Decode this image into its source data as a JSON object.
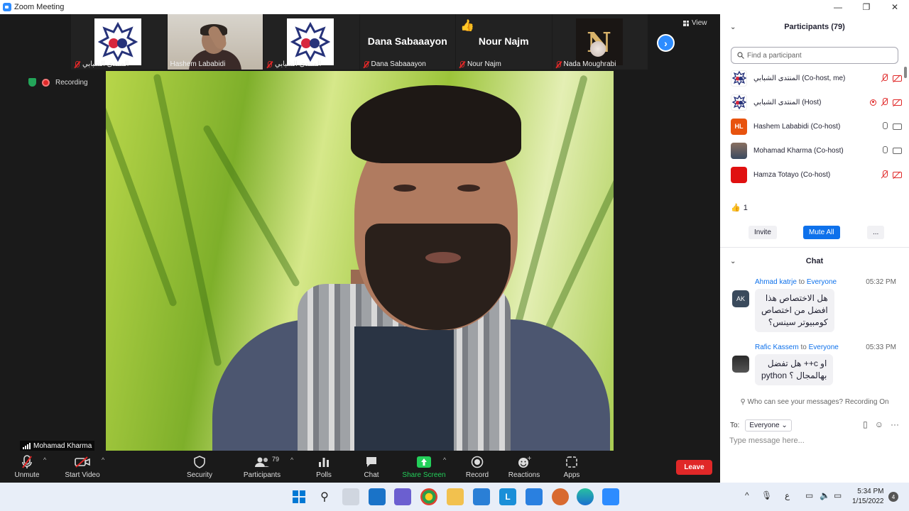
{
  "window": {
    "title": "Zoom Meeting"
  },
  "strip": {
    "tiles": [
      {
        "name": "المنتدى الشبابي",
        "type": "logo"
      },
      {
        "name": "Hashem Lababidi",
        "type": "video"
      },
      {
        "name": "المنتدى الشبابي",
        "type": "logo"
      },
      {
        "name": "Dana Sabaaayon",
        "type": "text",
        "big": "Dana Sabaaayon"
      },
      {
        "name": "Nour Najm",
        "type": "text",
        "big": "Nour Najm",
        "reaction": "👍"
      },
      {
        "name": "Nada Moughrabi",
        "type": "photo"
      }
    ],
    "view_label": "View"
  },
  "status": {
    "recording": "Recording"
  },
  "active_speaker": {
    "name": "Mohamad Kharma"
  },
  "toolbar": {
    "unmute": "Unmute",
    "start_video": "Start Video",
    "security": "Security",
    "participants": "Participants",
    "participants_count": "79",
    "polls": "Polls",
    "chat": "Chat",
    "share_screen": "Share Screen",
    "record": "Record",
    "reactions": "Reactions",
    "apps": "Apps",
    "leave": "Leave"
  },
  "participants_panel": {
    "title": "Participants (79)",
    "search_placeholder": "Find a participant",
    "rows": [
      {
        "name": "المنتدى الشبابي (Co-host, me)",
        "avatar": "logo",
        "mic": "off",
        "cam": "off",
        "rec": false
      },
      {
        "name": "المنتدى الشبابي (Host)",
        "avatar": "logo",
        "mic": "off",
        "cam": "off",
        "rec": true
      },
      {
        "name": "Hashem Lababidi (Co-host)",
        "avatar": "HL",
        "avatar_color": "#e8530e",
        "mic": "on",
        "cam": "on",
        "rec": false
      },
      {
        "name": "Mohamad Kharma (Co-host)",
        "avatar": "photo",
        "mic": "on",
        "cam": "on",
        "rec": false
      },
      {
        "name": "Hamza Totayo (Co-host)",
        "avatar": "",
        "avatar_color": "#e01010",
        "mic": "off",
        "cam": "off",
        "rec": false
      }
    ],
    "reaction_summary": {
      "emoji": "👍",
      "count": "1"
    },
    "invite": "Invite",
    "mute_all": "Mute All",
    "more": "..."
  },
  "chat_panel": {
    "title": "Chat",
    "messages": [
      {
        "sender": "Ahmad katrje",
        "to": "to",
        "recipient": "Everyone",
        "time": "05:32 PM",
        "avatar": "AK",
        "text_lines": [
          "هل الاختصاص هذا",
          "افضل من اختصاص",
          "كومبيوتر سينس؟"
        ]
      },
      {
        "sender": "Rafic Kassem",
        "to": "to",
        "recipient": "Everyone",
        "time": "05:33 PM",
        "avatar": "photo",
        "text_lines": [
          "او c++ هل تفضل",
          "بهالمجال ؟ python"
        ]
      }
    ],
    "who_can_see": "Who can see your messages? Recording On",
    "to_label": "To:",
    "to_value": "Everyone",
    "input_placeholder": "Type message here..."
  },
  "taskbar": {
    "time": "5:34 PM",
    "date": "1/15/2022",
    "notifications": "4",
    "lang": "ع"
  },
  "colors": {
    "accent": "#2d8cff",
    "leave": "#e02828",
    "share_green": "#23d05a",
    "mute_all_blue": "#0e71eb"
  }
}
